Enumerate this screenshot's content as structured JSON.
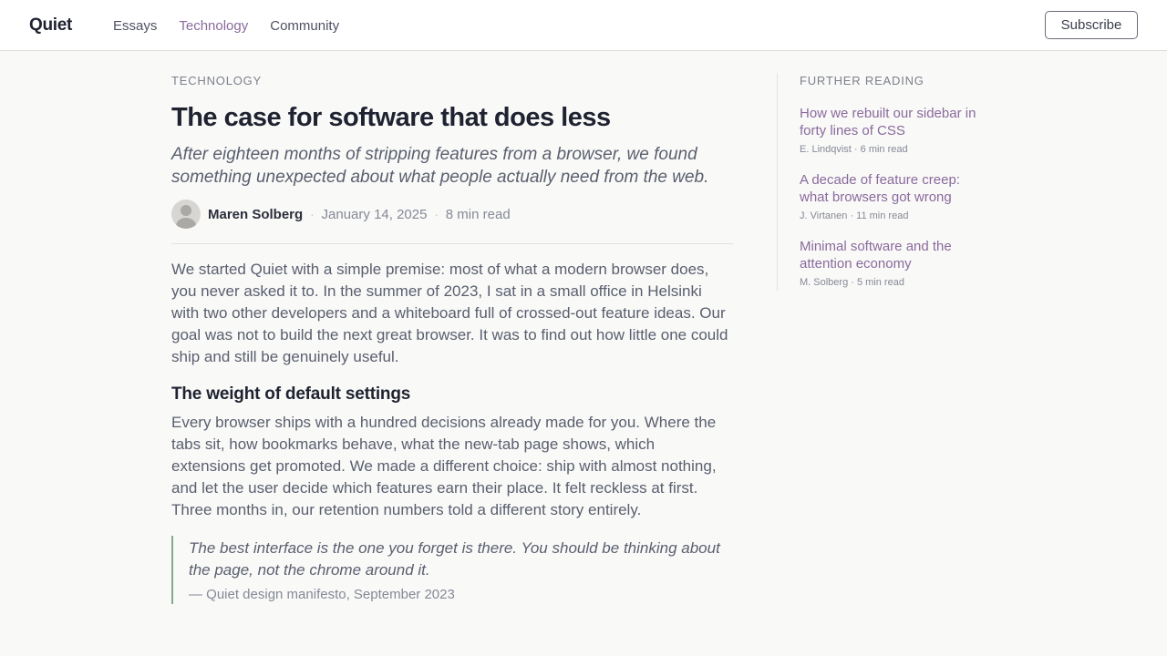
{
  "header": {
    "logo": "Quiet",
    "nav": [
      {
        "label": "Essays",
        "active": false
      },
      {
        "label": "Technology",
        "active": true
      },
      {
        "label": "Community",
        "active": false
      }
    ],
    "subscribe_label": "Subscribe"
  },
  "article": {
    "category": "TECHNOLOGY",
    "title": "The case for software that does less",
    "dek": "After eighteen months of stripping features from a browser, we found something unexpected about what people actually need from the web.",
    "author": "Maren Solberg",
    "date": "January 14, 2025",
    "read_time": "8 min read",
    "paragraph_1": "We started Quiet with a simple premise: most of what a modern browser does, you never asked it to. In the summer of 2023, I sat in a small office in Helsinki with two other developers and a whiteboard full of crossed-out feature ideas. Our goal was not to build the next great browser. It was to find out how little one could ship and still be genuinely useful.",
    "subheading": "The weight of default settings",
    "paragraph_2": "Every browser ships with a hundred decisions already made for you. Where the tabs sit, how bookmarks behave, what the new-tab page shows, which extensions get promoted. We made a different choice: ship with almost nothing, and let the user decide which features earn their place. It felt reckless at first. Three months in, our retention numbers told a different story entirely.",
    "quote": "The best interface is the one you forget is there. You should be thinking about the page, not the chrome around it.",
    "quote_cite": "— Quiet design manifesto, September 2023"
  },
  "sidebar": {
    "heading": "FURTHER READING",
    "items": [
      {
        "title": "How we rebuilt our sidebar in forty lines of CSS",
        "meta": "E. Lindqvist · 6 min read"
      },
      {
        "title": "A decade of feature creep: what browsers got wrong",
        "meta": "J. Virtanen · 11 min read"
      },
      {
        "title": "Minimal software and the attention economy",
        "meta": "M. Solberg · 5 min read"
      }
    ]
  },
  "colors": {
    "accent": "#8a6a9c",
    "quote_border": "#86a88c",
    "background": "#f9f9f8",
    "heading": "#1f2230"
  },
  "icons": {
    "avatar": "user-avatar-icon"
  }
}
